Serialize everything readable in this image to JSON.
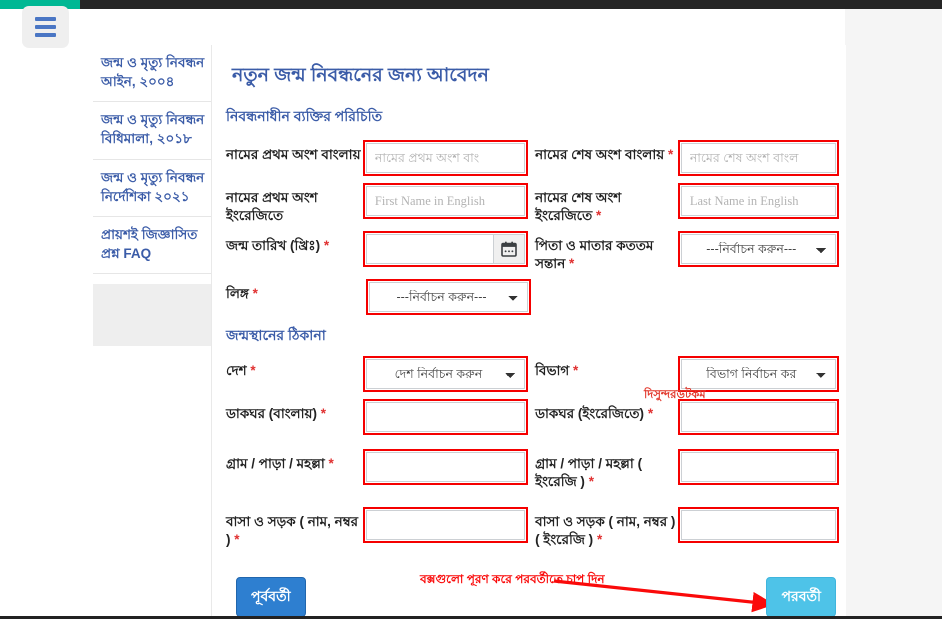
{
  "topbar": {
    "accent_teal": "#00b894",
    "dark": "#252525",
    "menu_icon": "hamburger-menu-icon"
  },
  "sidebar": {
    "items": [
      {
        "label": "জন্ম ও মৃত্যু নিবন্ধন আইন, ২০০৪"
      },
      {
        "label": "জন্ম ও মৃত্যু নিবন্ধন বিধিমালা, ২০১৮"
      },
      {
        "label": "জন্ম ও মৃত্যু নিবন্ধন নির্দেশিকা ২০২১"
      },
      {
        "label": "প্রায়শই জিজ্ঞাসিত প্রশ্ন FAQ"
      }
    ]
  },
  "form": {
    "title": "নতুন জন্ম নিবন্ধনের জন্য আবেদন",
    "section_identity": "নিবন্ধনাধীন ব্যক্তির পরিচিতি",
    "section_address": "জন্মস্থানের ঠিকানা",
    "watermark": "দিসুন্দরডটকম",
    "required_mark": "*",
    "fields": {
      "first_name_bn": {
        "label": "নামের প্রথম অংশ বাংলায়",
        "placeholder": "নামের প্রথম অংশ বাং",
        "value": ""
      },
      "last_name_bn": {
        "label": "নামের শেষ অংশ বাংলায়",
        "placeholder": "নামের শেষ অংশ বাংল",
        "value": ""
      },
      "first_name_en": {
        "label": "নামের প্রথম অংশ ইংরেজিতে",
        "placeholder": "First Name in English",
        "value": ""
      },
      "last_name_en": {
        "label": "নামের শেষ অংশ ইংরেজিতে",
        "placeholder": "Last Name in English",
        "value": ""
      },
      "birth_date": {
        "label": "জন্ম তারিখ (খ্রিঃ)",
        "placeholder": "",
        "value": "",
        "icon": "calendar-icon"
      },
      "birth_order": {
        "label": "পিতা ও মাতার কততম সন্তান",
        "selected": "---নির্বাচন করুন---"
      },
      "gender": {
        "label": "লিঙ্গ",
        "selected": "---নির্বাচন করুন---"
      },
      "country": {
        "label": "দেশ",
        "selected": "দেশ নির্বাচন করুন"
      },
      "division": {
        "label": "বিভাগ",
        "selected": "বিভাগ নির্বাচন কর"
      },
      "post_office_bn": {
        "label": "ডাকঘর (বাংলায়)",
        "value": ""
      },
      "post_office_en": {
        "label": "ডাকঘর (ইংরেজিতে)",
        "value": ""
      },
      "village_bn": {
        "label": "গ্রাম / পাড়া / মহল্লা",
        "value": ""
      },
      "village_en": {
        "label": "গ্রাম / পাড়া / মহল্লা ( ইংরেজি )",
        "value": ""
      },
      "house_road_bn": {
        "label": "বাসা ও সড়ক ( নাম, নম্বর )",
        "value": ""
      },
      "house_road_en": {
        "label": "বাসা ও সড়ক ( নাম, নম্বর ) ( ইংরেজি )",
        "value": ""
      }
    }
  },
  "footer": {
    "previous_label": "পূর্ববর্তী",
    "next_label": "পরবর্তী",
    "annotation": "বক্সগুলো পূরণ করে পরবর্তীতে চাপ দিন",
    "annotation_color": "#fa0a0a",
    "arrow": "red-arrow-annotation"
  },
  "colors": {
    "field_highlight": "#f50000",
    "heading_blue": "#3b5ca8",
    "prev_button": "#2e7fd0",
    "next_button": "#4ec3e8"
  }
}
